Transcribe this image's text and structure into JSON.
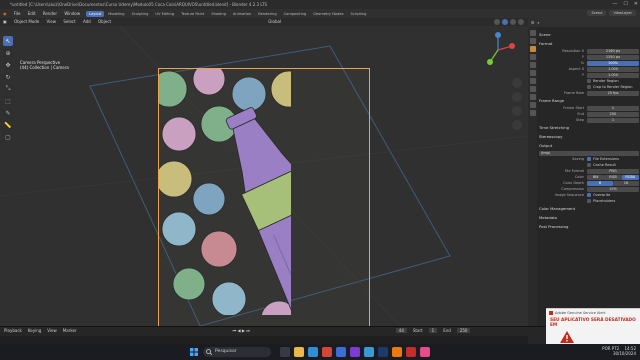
{
  "window": {
    "title": "*untitled [C:\\Users\\aluiz\\OneDrive\\Documentos\\Curso Udemy\\Modulo05 Coca Cola\\ARQUIVOS\\untitled.blend] - Blender 4.2.3 LTS"
  },
  "menu": [
    "File",
    "Edit",
    "Render",
    "Window",
    "Help"
  ],
  "workspace_tabs": [
    "Layout",
    "Modeling",
    "Sculpting",
    "UV Editing",
    "Texture Paint",
    "Shading",
    "Animation",
    "Rendering",
    "Compositing",
    "Geometry Nodes",
    "Scripting"
  ],
  "active_tab": "Layout",
  "scene_fields": {
    "scene": "Scene",
    "view_layer": "ViewLayer"
  },
  "viewport_header": {
    "mode": "Object Mode",
    "items": [
      "View",
      "Select",
      "Add",
      "Object"
    ],
    "pivot": "Global"
  },
  "viewport_overlay": {
    "line1": "Camera Perspective",
    "line2": "(44) Collection | Camera"
  },
  "properties": {
    "search_placeholder": "",
    "scene_name": "Scene",
    "format_title": "Format",
    "resolution_x": "2160 px",
    "resolution_y": "1350 px",
    "resolution_pct": "100%",
    "aspect_x": "1.000",
    "aspect_y": "1.000",
    "render_region": "Render Region",
    "crop": "Crop to Render Region",
    "frame_rate": "25 fps",
    "frame_range_title": "Frame Range",
    "frame_start": "1",
    "frame_end": "250",
    "frame_step": "1",
    "time_stretching": "Time Stretching",
    "stereoscopy": "Stereoscopy",
    "output_title": "Output",
    "output_path": "/tmp\\",
    "saving": "Saving",
    "file_extensions": "File Extensions",
    "cache_result": "Cache Result",
    "file_format": "PNG",
    "color_bw": "BW",
    "color_rgb": "RGB",
    "color_rgba": "RGBA",
    "color_depth_8": "8",
    "color_depth_16": "16",
    "compression": "15%",
    "image_sequence": "Image Sequence",
    "overwrite": "Overwrite",
    "placeholders": "Placeholders",
    "color_management": "Color Management",
    "metadata": "Metadata",
    "post_processing": "Post Processing",
    "labels": {
      "resolution_x": "Resolution X",
      "resolution_y": "Y",
      "resolution_pct": "%",
      "aspect_x": "Aspect X",
      "aspect_y": "Y",
      "frame_rate": "Frame Rate",
      "frame_start": "Frame Start",
      "frame_end": "End",
      "frame_step": "Step",
      "file_format": "File Format",
      "color": "Color",
      "color_depth": "Color Depth",
      "compression": "Compression"
    }
  },
  "timeline": {
    "playback": "Playback",
    "keying": "Keying",
    "view": "View",
    "marker": "Marker",
    "current_frame": "44",
    "start_label": "Start",
    "start": "1",
    "end_label": "End",
    "end": "250"
  },
  "taskbar": {
    "search": "Pesquisar",
    "language": "POR PT2",
    "time": "14:52",
    "date": "30/10/2024"
  },
  "notification": {
    "app": "Adobe Genuine Service Alert",
    "message": "SEU APLICATIVO SERÁ DESATIVADO EM"
  },
  "colors": {
    "accent": "#4a6fb5",
    "camera_frame": "#f0a24a",
    "bottle": "#9a7fc4",
    "label_band": "#a6c07a"
  }
}
